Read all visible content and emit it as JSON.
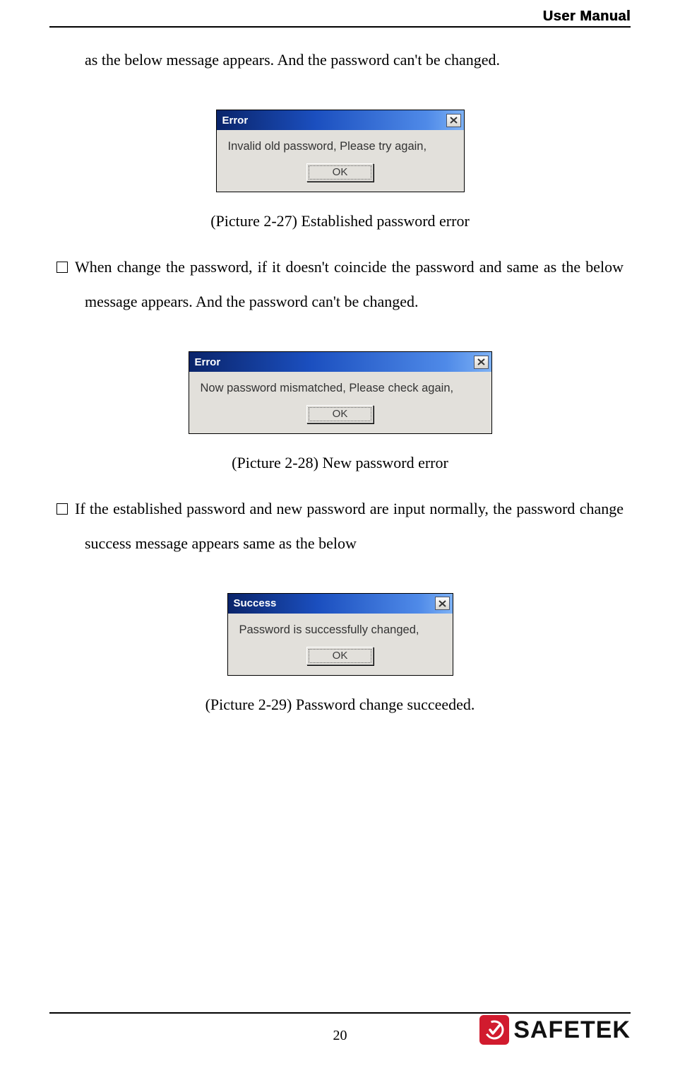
{
  "header": {
    "title": "User Manual"
  },
  "para1": "as the below message appears. And the password can't be changed.",
  "dialog1": {
    "title": "Error",
    "message": "Invalid old password, Please try again,",
    "ok": "OK"
  },
  "caption1": "(Picture 2-27) Established password error",
  "para2": "When change the password, if it doesn't coincide the password and same as the below message appears. And the password can't be changed.",
  "dialog2": {
    "title": "Error",
    "message": "Now password mismatched, Please check again,",
    "ok": "OK"
  },
  "caption2": "(Picture 2-28) New password error",
  "para3": "If the established password and new password are input normally, the password change success message appears same as the below",
  "dialog3": {
    "title": "Success",
    "message": "Password is successfully changed,",
    "ok": "OK"
  },
  "caption3": "(Picture 2-29) Password change succeeded.",
  "footer": {
    "page_no": "20",
    "brand": "SAFETEK"
  }
}
